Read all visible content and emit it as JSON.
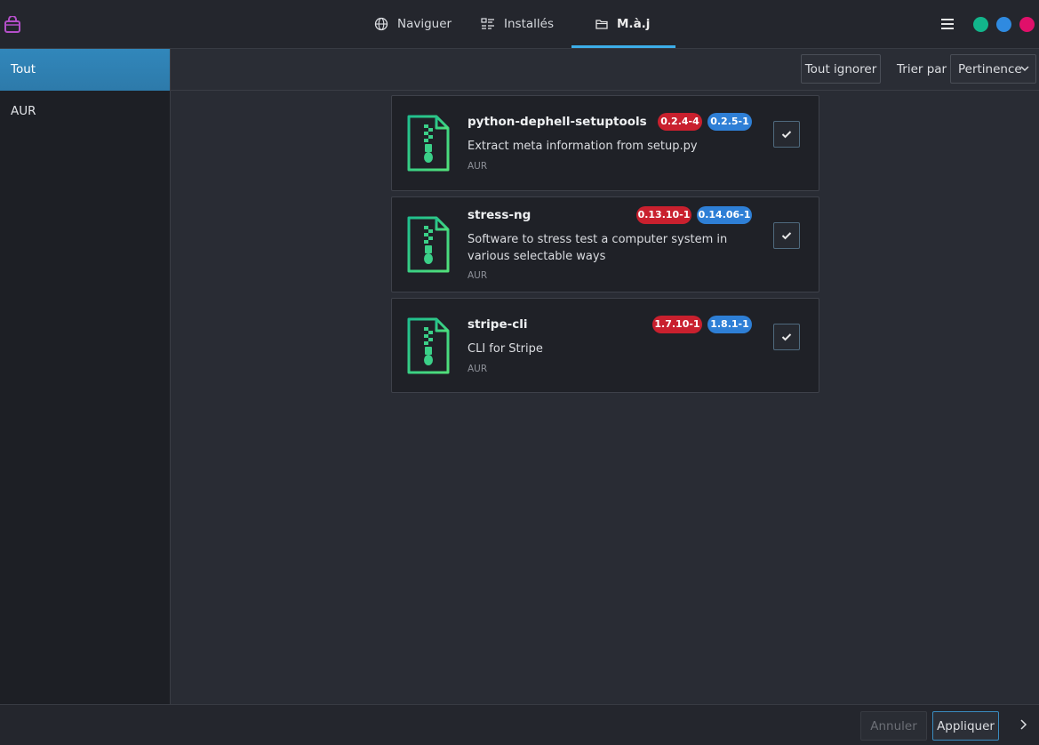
{
  "header": {
    "tabs": [
      {
        "label": "Naviguer",
        "icon": "globe-icon"
      },
      {
        "label": "Installés",
        "icon": "list-icon"
      },
      {
        "label": "M.à.j",
        "icon": "folder-icon"
      }
    ],
    "active_tab": "M.à.j",
    "window_dots": [
      "#12b58b",
      "#2f8ae0",
      "#e0106a"
    ]
  },
  "sidebar": {
    "items": [
      {
        "label": "Tout",
        "active": true
      },
      {
        "label": "AUR",
        "active": false
      }
    ]
  },
  "toolbar": {
    "ignore_all_label": "Tout ignorer",
    "sort_label": "Trier par",
    "sort_value": "Pertinence"
  },
  "packages": [
    {
      "name": "python-dephell-setuptools",
      "description": "Extract meta information from setup.py",
      "repo": "AUR",
      "old_version": "0.2.4-4",
      "new_version": "0.2.5-1",
      "checked": true
    },
    {
      "name": "stress-ng",
      "description": "Software to stress test a computer system in various selectable ways",
      "repo": "AUR",
      "old_version": "0.13.10-1",
      "new_version": "0.14.06-1",
      "checked": true
    },
    {
      "name": "stripe-cli",
      "description": "CLI for Stripe",
      "repo": "AUR",
      "old_version": "1.7.10-1",
      "new_version": "1.8.1-1",
      "checked": true
    }
  ],
  "footer": {
    "cancel_label": "Annuler",
    "apply_label": "Appliquer"
  },
  "colors": {
    "accent": "#3daee9",
    "old_version": "#c9202e",
    "new_version": "#2e7fd6"
  }
}
